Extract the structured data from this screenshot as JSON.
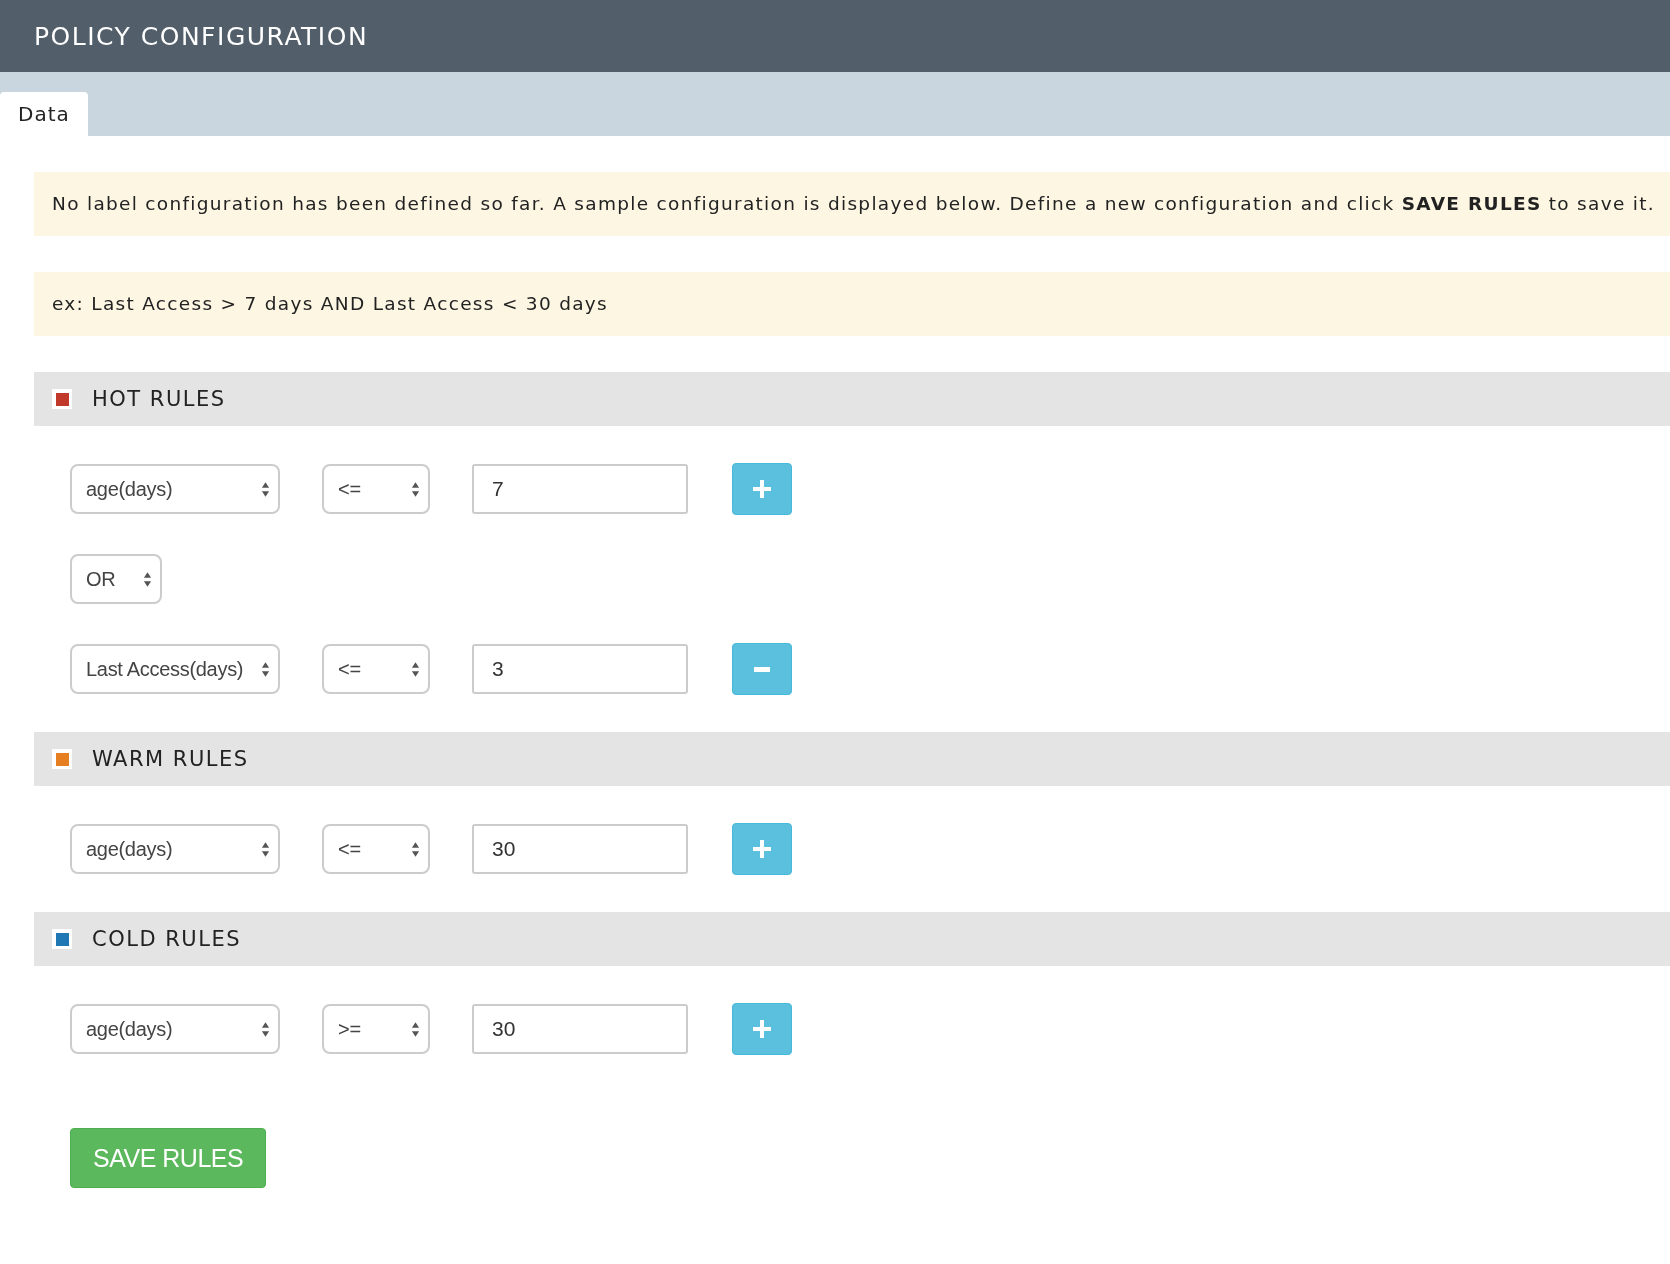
{
  "header": {
    "title": "POLICY CONFIGURATION"
  },
  "tabs": [
    {
      "label": "Data",
      "selected": true
    }
  ],
  "notice": "No label configuration has been defined so far. A sample configuration is displayed below. Define a new configuration and click **SAVE RULES** to save it.",
  "example": "ex: Last Access > 7 days AND Last Access < 30 days",
  "sections": [
    {
      "title": "HOT RULES",
      "color": "#c0392b",
      "rows": [
        {
          "kind": "rule",
          "field": "age(days)",
          "operator": "<=",
          "value": "7",
          "button": {
            "kind": "add"
          }
        },
        {
          "kind": "connector",
          "value": "OR"
        },
        {
          "kind": "rule",
          "field": "Last Access(days)",
          "operator": "<=",
          "value": "3",
          "button": {
            "kind": "remove"
          }
        }
      ]
    },
    {
      "title": "WARM RULES",
      "color": "#e67e22",
      "rows": [
        {
          "kind": "rule",
          "field": "age(days)",
          "operator": "<=",
          "value": "30",
          "button": {
            "kind": "add"
          }
        }
      ]
    },
    {
      "title": "COLD RULES",
      "color": "#1f77b4",
      "rows": [
        {
          "kind": "rule",
          "field": "age(days)",
          "operator": ">=",
          "value": "30",
          "button": {
            "kind": "add"
          }
        }
      ]
    }
  ],
  "save_button": "SAVE RULES"
}
